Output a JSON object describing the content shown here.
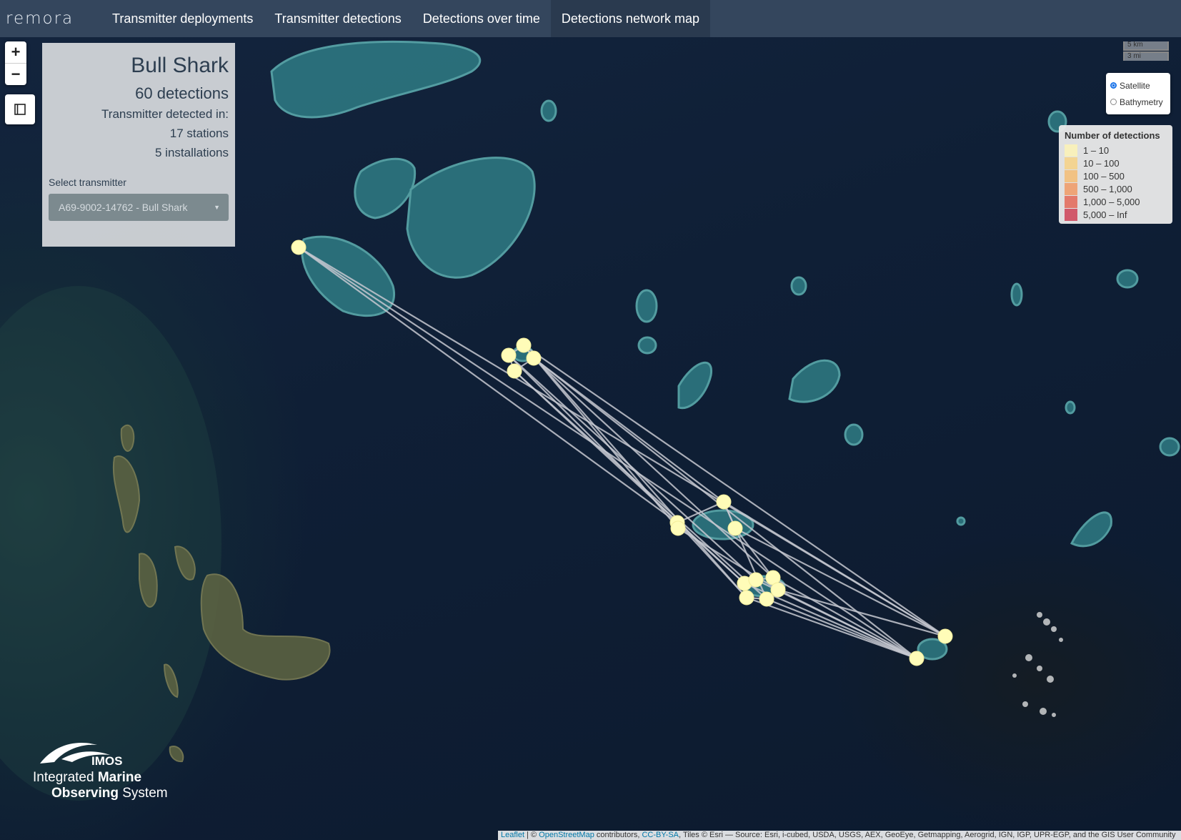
{
  "navbar": {
    "brand": "remora",
    "tabs": [
      {
        "label": "Transmitter deployments"
      },
      {
        "label": "Transmitter detections"
      },
      {
        "label": "Detections over time"
      },
      {
        "label": "Detections network map"
      }
    ],
    "active_tab": "Detections network map"
  },
  "map": {
    "zoom_in": "+",
    "zoom_out": "−",
    "info": {
      "title": "Bull Shark",
      "detections": "60 detections",
      "detected_in": "Transmitter detected in:",
      "stations": "17 stations",
      "installations": "5 installations",
      "select_label": "Select transmitter",
      "select_value": "A69-9002-14762 - Bull Shark"
    },
    "scale": {
      "km": "5 km",
      "mi": "3 mi"
    },
    "basemaps": {
      "options": [
        "Satellite",
        "Bathymetry"
      ],
      "selected": "Satellite"
    },
    "legend": {
      "title": "Number of detections",
      "items": [
        {
          "label": "1 – 10",
          "color": "#fbf2b8"
        },
        {
          "label": "10 – 100",
          "color": "#f5d38a"
        },
        {
          "label": "100 – 500",
          "color": "#f3bf7a"
        },
        {
          "label": "500 – 1,000",
          "color": "#ef9d6b"
        },
        {
          "label": "1,000 – 5,000",
          "color": "#e36e5e"
        },
        {
          "label": "5,000 – Inf",
          "color": "#cf4a5e"
        }
      ]
    },
    "marker_color": "#fffcb8",
    "link_color": "#c6c8d0",
    "attribution": {
      "leaflet": "Leaflet",
      "sep1": " | © ",
      "osm": "OpenStreetMap",
      "contrib": " contributors, ",
      "license": "CC-BY-SA",
      "tiles": ", Tiles © Esri — Source: Esri, i-cubed, USDA, USGS, AEX, GeoEye, Getmapping, Aerogrid, IGN, IGP, UPR-EGP, and the GIS User Community"
    },
    "logo": {
      "wordmark": "IMOS",
      "line1_pre": "Integrated ",
      "line1_bold": "Marine",
      "line2_bold": "Observing",
      "line2_post": " System"
    }
  }
}
